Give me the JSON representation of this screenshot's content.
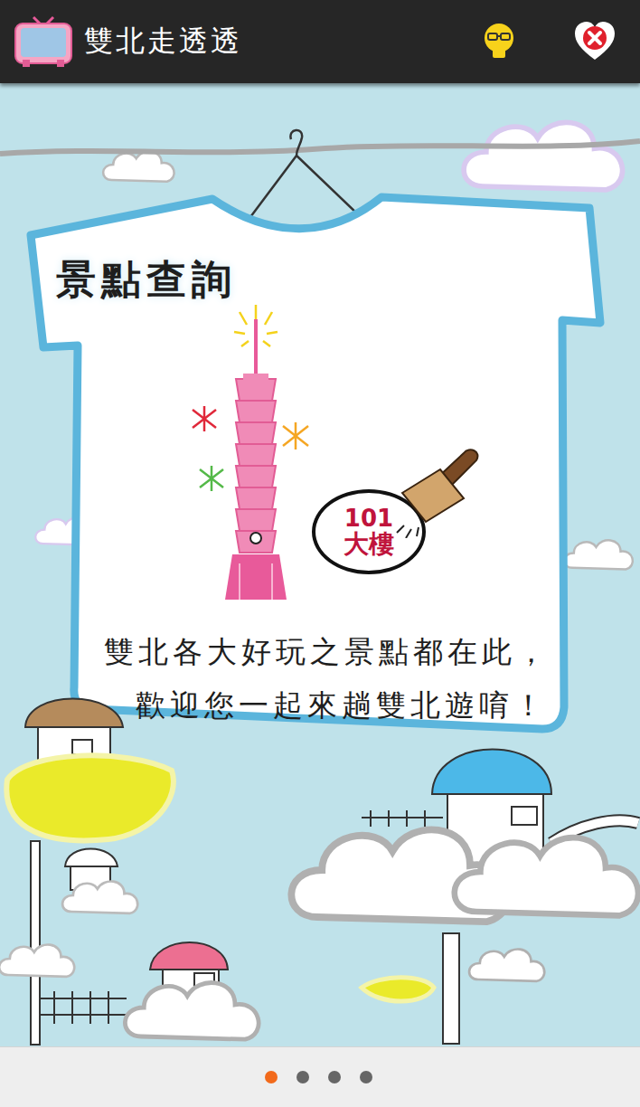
{
  "app_bar": {
    "title": "雙北走透透"
  },
  "card": {
    "heading": "景點查詢",
    "stamp": {
      "number": "101",
      "label": "大樓"
    },
    "lines": [
      "雙北各大好玩之景點都在此，",
      "歡迎您一起來趟雙北遊唷！"
    ]
  },
  "pager": {
    "dots": [
      {
        "selected": true
      },
      {
        "selected": false
      },
      {
        "selected": false
      },
      {
        "selected": false
      }
    ]
  }
}
